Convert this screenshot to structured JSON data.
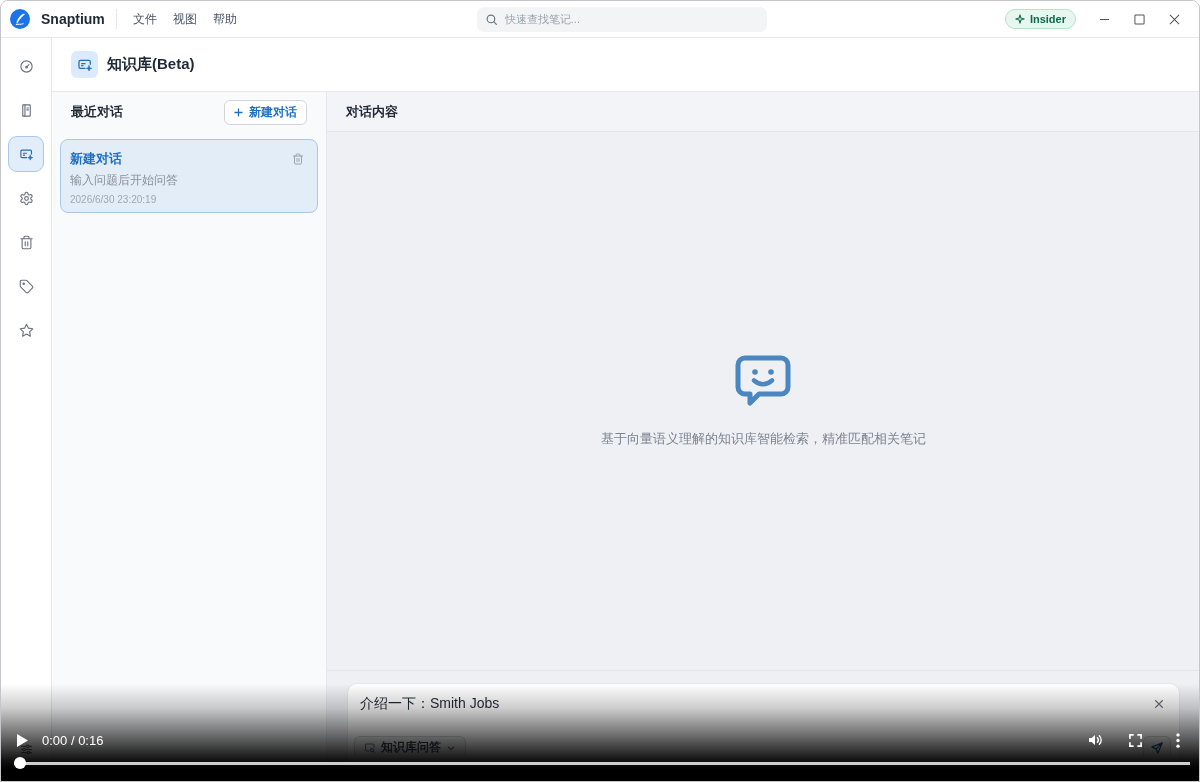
{
  "window": {
    "app_name": "Snaptium",
    "menu": [
      "文件",
      "视图",
      "帮助"
    ],
    "search": {
      "placeholder": "快速查找笔记..."
    },
    "badge": "Insider"
  },
  "nav_rail": {
    "items": [
      {
        "selected": false
      },
      {
        "selected": false
      },
      {
        "selected": true
      },
      {
        "selected": false
      },
      {
        "selected": false
      },
      {
        "selected": false
      },
      {
        "selected": false
      }
    ]
  },
  "page_header": {
    "title": "知识库(Beta)"
  },
  "conversations": {
    "heading": "最近对话",
    "new_button": "新建对话",
    "items": [
      {
        "title": "新建对话",
        "preview": "输入问题后开始问答",
        "time": "2026/6/30 23:20:19",
        "selected": true
      }
    ]
  },
  "chat": {
    "heading": "对话内容",
    "empty_message": "基于向量语义理解的知识库智能检索，精准匹配相关笔记",
    "input": {
      "value": "介绍一下：Smith Jobs"
    },
    "mode_button": "知识库问答"
  },
  "video_player": {
    "time": "0:00 / 0:16",
    "progress": {
      "level": 0
    }
  }
}
